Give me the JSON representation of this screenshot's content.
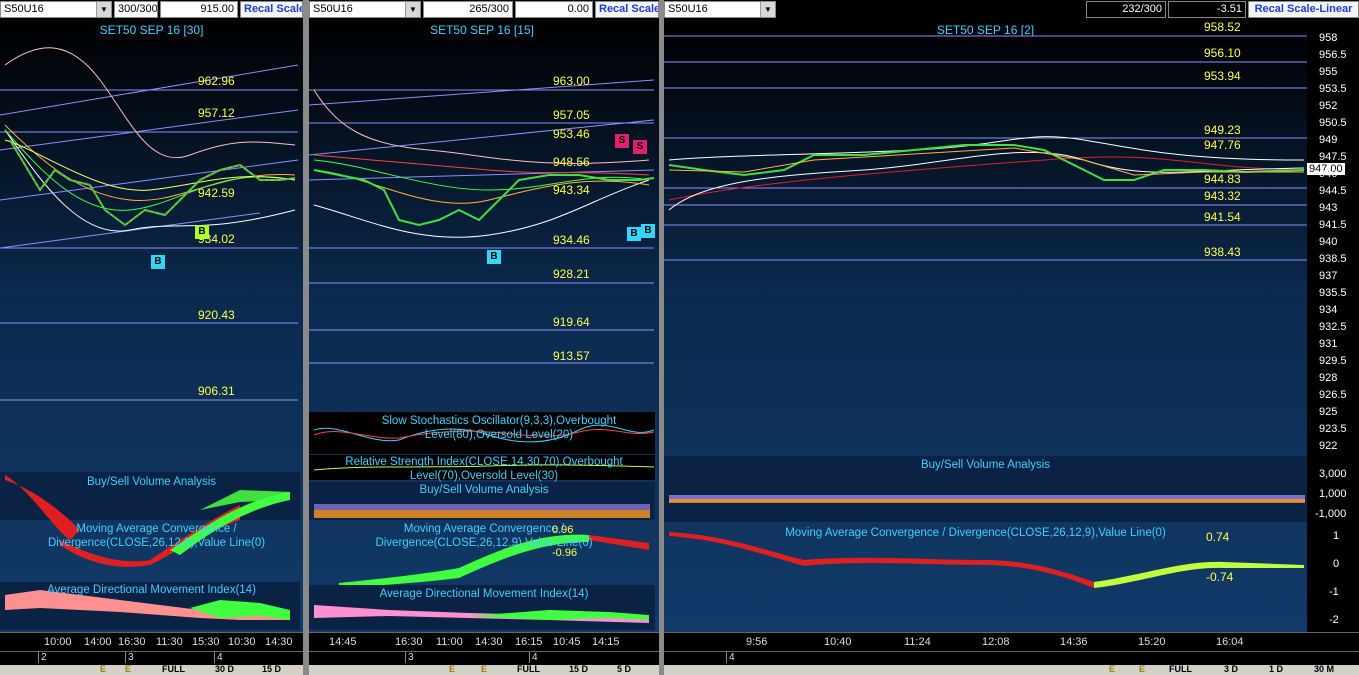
{
  "panels": [
    {
      "symbol": "S50U16",
      "count": "300/300",
      "value": "915.00",
      "button": "Recal Scale",
      "title": "SET50 SEP 16  [30]",
      "levels": [
        "962.96",
        "957.12",
        "942.59",
        "934.02",
        "920.43",
        "906.31"
      ],
      "markers": [
        "B",
        "B"
      ],
      "indicators": [
        "Buy/Sell Volume Analysis",
        "Moving Average Convergence / Divergence(CLOSE,26,12,9),Value Line(0)",
        "Average Directional Movement Index(14)"
      ],
      "times": [
        "10:00",
        "14:00",
        "16:30",
        "11:30",
        "15:30",
        "10:30",
        "14:30"
      ],
      "dates": [
        "2",
        "3",
        "4"
      ],
      "tabs": [
        "E",
        "E",
        "FULL",
        "30 D",
        "15 D"
      ]
    },
    {
      "symbol": "S50U16",
      "count": "265/300",
      "value": "0.00",
      "button": "Recal Scale",
      "title": "SET50 SEP 16  [15]",
      "levels": [
        "963.00",
        "957.05",
        "953.46",
        "948.56",
        "943.34",
        "934.46",
        "928.21",
        "919.64",
        "913.57"
      ],
      "markers": [
        "B",
        "S",
        "S",
        "B",
        "B"
      ],
      "indicators": [
        "Slow Stochastics Oscillator(9,3,3),Overbought Level(80),Oversold Level(20)",
        "Relative Strength Index(CLOSE,14,30,70),Overbought Level(70),Oversold Level(30)",
        "Buy/Sell Volume Analysis",
        "Moving Average Convergence / Divergence(CLOSE,26,12,9),Value Line(0)",
        "Average Directional Movement Index(14)"
      ],
      "macd_vals": [
        "0.96",
        "-0.96"
      ],
      "times": [
        "14:45",
        "16:30",
        "11:00",
        "14:30",
        "16:15",
        "10:45",
        "14:15"
      ],
      "dates": [
        "3",
        "4"
      ],
      "tabs": [
        "E",
        "E",
        "FULL",
        "15 D",
        "5 D"
      ]
    },
    {
      "symbol": "S50U16",
      "count": "232/300",
      "value": "-3.51",
      "button": "Recal Scale-Linear",
      "title": "SET50 SEP 16  [2]",
      "levels": [
        "958.52",
        "956.10",
        "953.94",
        "949.23",
        "947.76",
        "944.83",
        "943.32",
        "941.54",
        "938.43"
      ],
      "price_tag": "947.00",
      "yaxis": [
        "958",
        "956.5",
        "955",
        "953.5",
        "952",
        "950.5",
        "949",
        "947.5",
        "946",
        "944.5",
        "943",
        "941.5",
        "940",
        "938.5",
        "937",
        "935.5",
        "934",
        "932.5",
        "931",
        "929.5",
        "928",
        "926.5",
        "925",
        "923.5",
        "922"
      ],
      "indicators": [
        "Buy/Sell Volume Analysis",
        "Moving Average Convergence / Divergence(CLOSE,26,12,9),Value Line(0)"
      ],
      "vol_axis": [
        "3,000",
        "1,000",
        "-1,000"
      ],
      "macd_axis": [
        "1",
        "0",
        "-1",
        "-2"
      ],
      "macd_vals": [
        "0.74",
        "-0.74"
      ],
      "times": [
        "9:56",
        "10:40",
        "11:24",
        "12:08",
        "14:36",
        "15:20",
        "16:04"
      ],
      "dates": [
        "4"
      ],
      "tabs": [
        "E",
        "E",
        "FULL",
        "3 D",
        "1 D",
        "30 M"
      ]
    }
  ]
}
